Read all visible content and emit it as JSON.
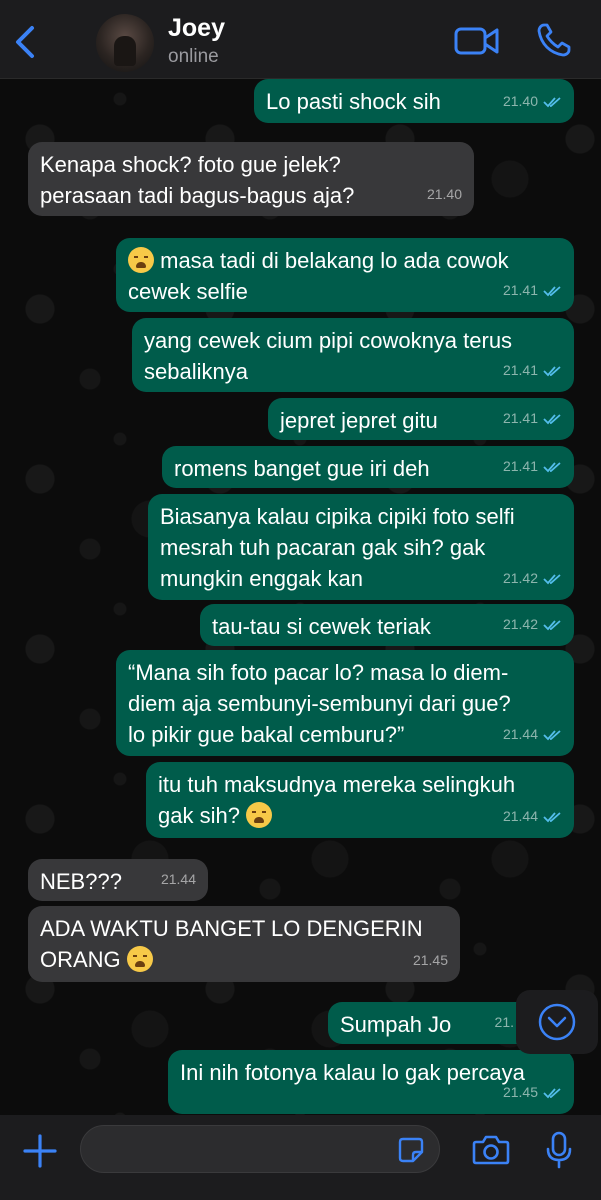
{
  "header": {
    "name": "Joey",
    "status": "online"
  },
  "colors": {
    "accent": "#3b82f6",
    "outgoing_bubble": "#005c4b",
    "incoming_bubble": "#38383a",
    "read_ticks": "#53bdeb"
  },
  "messages": [
    {
      "dir": "out",
      "text": "Lo pasti shock sih",
      "time": "21.40",
      "read": true
    },
    {
      "dir": "in",
      "text": "Kenapa shock? foto gue jelek?\nperasaan tadi bagus-bagus aja?",
      "time": "21.40"
    },
    {
      "dir": "out",
      "emoji": "loudly-crying-face-emoji",
      "text": "masa tadi di belakang lo ada cowok\ncewek selfie",
      "time": "21.41",
      "read": true
    },
    {
      "dir": "out",
      "text": "yang cewek cium pipi cowoknya terus\nsebaliknya",
      "time": "21.41",
      "read": true
    },
    {
      "dir": "out",
      "text": "jepret jepret gitu",
      "time": "21.41",
      "read": true
    },
    {
      "dir": "out",
      "text": "romens banget gue iri deh",
      "time": "21.41",
      "read": true
    },
    {
      "dir": "out",
      "text": "Biasanya kalau cipika cipiki foto selfi\nmesrah tuh pacaran gak sih? gak\nmungkin enggak kan",
      "time": "21.42",
      "read": true
    },
    {
      "dir": "out",
      "text": "tau-tau si cewek teriak",
      "time": "21.42",
      "read": true
    },
    {
      "dir": "out",
      "text": "“Mana sih foto pacar lo? masa lo diem-\ndiem aja sembunyi-sembunyi dari gue?\nlo pikir gue bakal cemburu?”",
      "time": "21.44",
      "read": true
    },
    {
      "dir": "out",
      "text": "itu tuh maksudnya mereka selingkuh\ngak sih?",
      "emoji_after": "loudly-crying-face-emoji",
      "time": "21.44",
      "read": true
    },
    {
      "dir": "in",
      "text": "NEB???",
      "time": "21.44"
    },
    {
      "dir": "in",
      "text": "ADA WAKTU BANGET LO DENGERIN\nORANG",
      "emoji_after": "loudly-crying-face-emoji",
      "time": "21.45"
    },
    {
      "dir": "out",
      "text": "Sumpah Jo",
      "time": "21.",
      "read": true
    },
    {
      "dir": "out",
      "text": "Ini nih fotonya kalau lo gak percaya",
      "time": "21.45",
      "read": true
    }
  ],
  "composer": {
    "placeholder": ""
  }
}
